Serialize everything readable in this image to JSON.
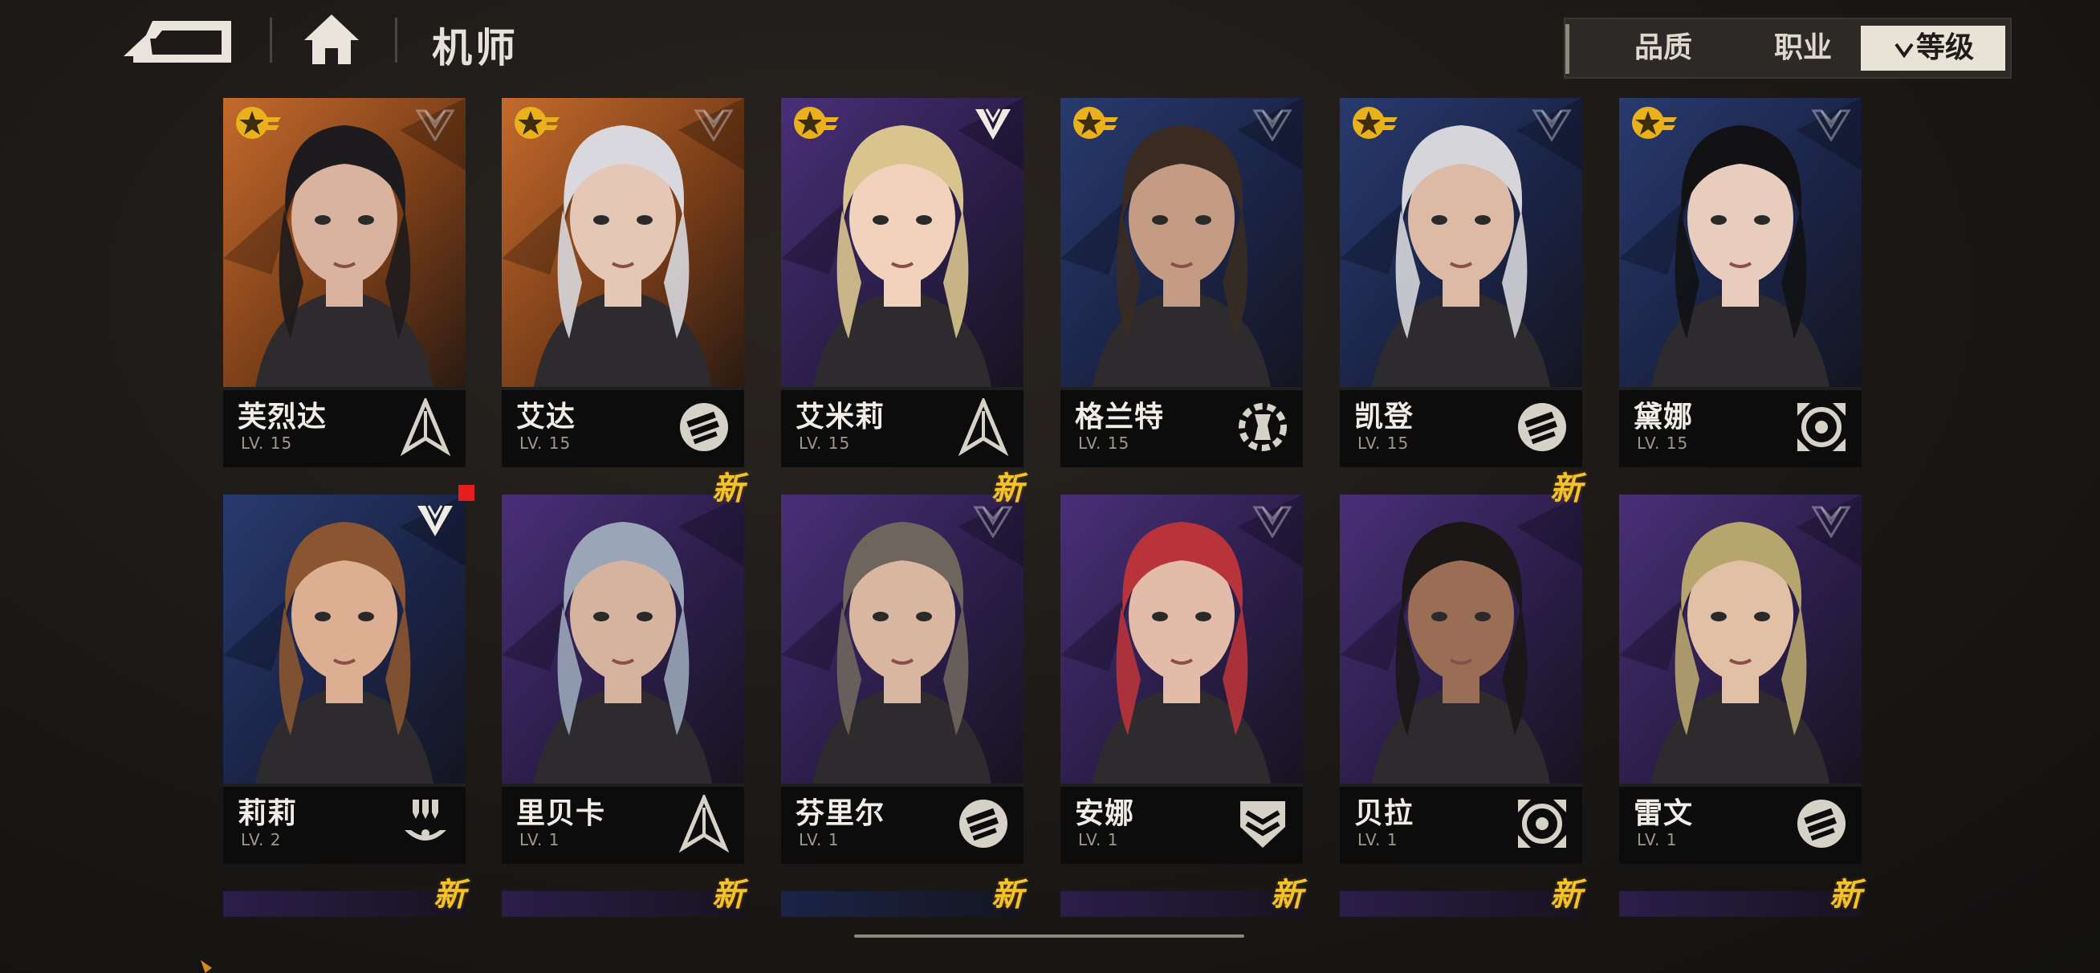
{
  "header": {
    "title": "机师"
  },
  "filters": [
    {
      "label": "品质",
      "active": false
    },
    {
      "label": "职业",
      "active": false
    },
    {
      "label": "等级",
      "active": true,
      "icon": "chevron-down-icon"
    }
  ],
  "colors": {
    "new_badge": "#f3c22d",
    "active_filter": "#e8e3d7",
    "notify": "#e61d1d"
  },
  "new_label": "新",
  "pilots": [
    {
      "name": "芙烈达",
      "level": "LV. 15",
      "bg": "orange",
      "rank": "star-badge",
      "faction": "faction-emblem-icon",
      "class": "arrow-class-icon",
      "new": false
    },
    {
      "name": "艾达",
      "level": "LV. 15",
      "bg": "orange",
      "rank": "star-badge",
      "faction": "faction-emblem-icon",
      "class": "fist-class-icon",
      "new": false
    },
    {
      "name": "艾米莉",
      "level": "LV. 15",
      "bg": "purple",
      "rank": "star-badge",
      "faction": "w-emblem-icon",
      "class": "arrow-class-icon",
      "new": false
    },
    {
      "name": "格兰特",
      "level": "LV. 15",
      "bg": "blue",
      "rank": "star-badge",
      "faction": "faction-emblem-icon",
      "class": "wrench-class-icon",
      "new": false
    },
    {
      "name": "凯登",
      "level": "LV. 15",
      "bg": "blue",
      "rank": "star-badge",
      "faction": "faction-emblem-icon",
      "class": "fist-class-icon",
      "new": false
    },
    {
      "name": "黛娜",
      "level": "LV. 15",
      "bg": "blue",
      "rank": "star-badge",
      "faction": "faction-emblem-icon",
      "class": "target-class-icon",
      "new": false
    },
    {
      "name": "莉莉",
      "level": "LV. 2",
      "bg": "blue",
      "rank": "",
      "faction": "w-emblem-icon",
      "class": "drone-class-icon",
      "new": false,
      "notify": true
    },
    {
      "name": "里贝卡",
      "level": "LV. 1",
      "bg": "purple",
      "rank": "",
      "faction": "",
      "class": "arrow-class-icon",
      "new": true
    },
    {
      "name": "芬里尔",
      "level": "LV. 1",
      "bg": "purple",
      "rank": "",
      "faction": "faction-emblem-icon",
      "class": "fist-class-icon",
      "new": true
    },
    {
      "name": "安娜",
      "level": "LV. 1",
      "bg": "purple",
      "rank": "",
      "faction": "faction-emblem-icon",
      "class": "shield-class-icon",
      "new": false
    },
    {
      "name": "贝拉",
      "level": "LV. 1",
      "bg": "purple",
      "rank": "",
      "faction": "",
      "class": "target-class-icon",
      "new": true
    },
    {
      "name": "雷文",
      "level": "LV. 1",
      "bg": "purple",
      "rank": "",
      "faction": "faction-emblem-icon",
      "class": "fist-class-icon",
      "new": false
    }
  ],
  "partial_row": [
    {
      "bg": "purple",
      "new": true
    },
    {
      "bg": "purple",
      "new": true
    },
    {
      "bg": "blue",
      "new": true
    },
    {
      "bg": "purple",
      "new": true
    },
    {
      "bg": "purple",
      "new": true
    },
    {
      "bg": "purple",
      "new": true
    }
  ]
}
